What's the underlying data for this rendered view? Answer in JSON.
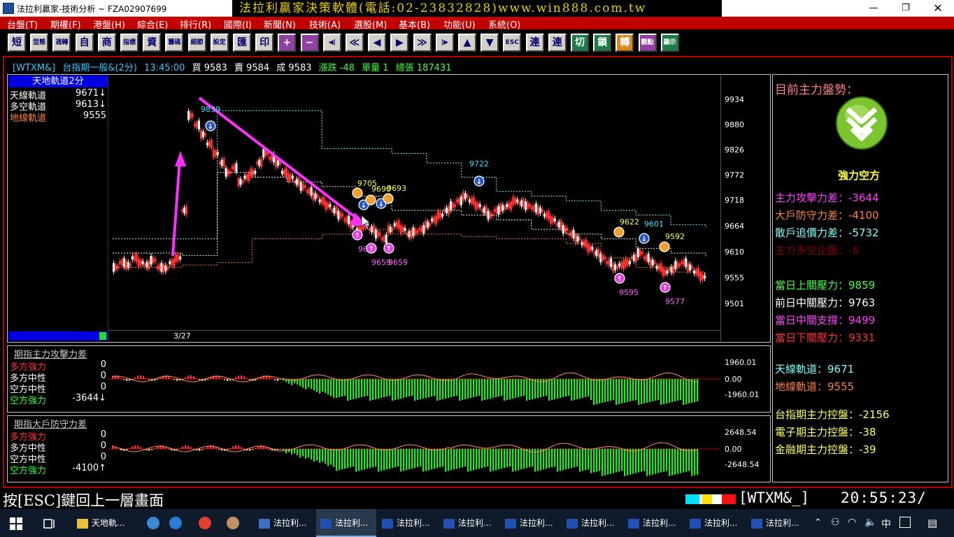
{
  "window": {
    "title": "法拉利贏家-技術分析 ~ FZA02907699",
    "ad_banner": "法拉利贏家決策軟體(電話:02-23832828)www.win888.com.tw"
  },
  "menu": [
    "台盤(T)",
    "期權(F)",
    "港盤(H)",
    "綜合(E)",
    "排行(R)",
    "國際(I)",
    "新聞(N)",
    "技術(A)",
    "選股(M)",
    "基本(B)",
    "功能(U)",
    "系統(O)"
  ],
  "toolbar": [
    "短",
    "型態",
    "週轉",
    "自",
    "商",
    "指標",
    "資",
    "籌碼",
    "細節",
    "設定",
    "匯",
    "印",
    "+",
    "−",
    "◀|",
    "≪",
    "◀",
    "▶",
    "≫",
    "|▶",
    "▲",
    "▼",
    "ESC",
    "連",
    "連",
    "切",
    "鎖",
    "轉",
    "觀點",
    "顯示"
  ],
  "ticker": {
    "symbol": "[WTXM&]",
    "name": "台指期一般&(2分)",
    "time": "13:45:00",
    "buy": "買 9583",
    "sell": "賣 9584",
    "deal": "成 9583",
    "change": "漲跌 -48",
    "volume": "單量 1",
    "total": "總張 187431"
  },
  "main_panel": {
    "title": "天地軌道2分",
    "legend": [
      {
        "label": "天線軌道",
        "value": "9671↓",
        "color": "#ffffff"
      },
      {
        "label": "多空軌道",
        "value": "9613↓",
        "color": "#ffffff"
      },
      {
        "label": "地線軌道",
        "value": "9555",
        "color": "#ff8040"
      }
    ],
    "date_label": "3/27",
    "y_ticks": [
      "9934",
      "9880",
      "9826",
      "9772",
      "9718",
      "9664",
      "9610",
      "9555",
      "9501"
    ],
    "signals_blue": [
      "9839",
      "9722",
      "9601"
    ],
    "signals_orange": [
      "9705",
      "9693",
      "9690",
      "9622",
      "9592"
    ],
    "signals_pink": [
      "96",
      "9659",
      "9659",
      "9595",
      "9577"
    ]
  },
  "sub_panel_1": {
    "title": "期指主力攻擊力差",
    "legend": [
      {
        "label": "多方強力",
        "value": "0",
        "color": "#ff3030"
      },
      {
        "label": "多方中性",
        "value": "0",
        "color": "#ffffff"
      },
      {
        "label": "空方中性",
        "value": "0",
        "color": "#ffffff"
      },
      {
        "label": "空方強力",
        "value": "-3644↓",
        "color": "#30ff30"
      }
    ],
    "y_ticks": [
      "1960.01",
      "0.00",
      "-1960.01"
    ]
  },
  "sub_panel_2": {
    "title": "期指大戶防守力差",
    "legend": [
      {
        "label": "多方強力",
        "value": "0",
        "color": "#ff3030"
      },
      {
        "label": "多方中性",
        "value": "0",
        "color": "#ffffff"
      },
      {
        "label": "空方中性",
        "value": "0",
        "color": "#ffffff"
      },
      {
        "label": "空方強力",
        "value": "-4100↑",
        "color": "#30ff30"
      }
    ],
    "y_ticks": [
      "2648.54",
      "0.00",
      "-2648.54"
    ]
  },
  "right_panel": {
    "heading": "目前主力盤勢：",
    "trend_label": "強力空方",
    "group1": [
      {
        "text": "主力攻擊力差：-3644",
        "color": "#ff40ff"
      },
      {
        "text": "大戶防守力差：-4100",
        "color": "#ff8040"
      },
      {
        "text": "散戶追價力差：-5732",
        "color": "#80ffff"
      },
      {
        "text": "主力多空企圖：-6",
        "color": "#800000"
      }
    ],
    "group2": [
      {
        "text": "當日上關壓力：9859",
        "color": "#40ff40"
      },
      {
        "text": "前日中關壓力：9763",
        "color": "#ffffff"
      },
      {
        "text": "當日中關支撐：9499",
        "color": "#ff40ff"
      },
      {
        "text": "當日下關壓力：9331",
        "color": "#ff3030"
      }
    ],
    "group3": [
      {
        "text": "天線軌道：9671",
        "color": "#80ffff"
      },
      {
        "text": "地線軌道：9555",
        "color": "#ff8040"
      }
    ],
    "group4": [
      {
        "text": "台指期主力控盤：-2156",
        "color": "#ffff60"
      },
      {
        "text": "電子期主力控盤：-38",
        "color": "#ffff60"
      },
      {
        "text": "金融期主力控盤：-39",
        "color": "#ffff60"
      }
    ]
  },
  "statusbar": {
    "hint": "按[ESC]鍵回上一層畫面",
    "symbol": "[WTXM&_]",
    "clock": "20:55:23/"
  },
  "taskbar": {
    "items": [
      "天地軌...",
      "法拉利...",
      "法拉利...",
      "法拉利...",
      "法拉利...",
      "法拉利...",
      "法拉利...",
      "法拉利...",
      "法拉利...",
      "法拉利..."
    ],
    "ime": "中"
  },
  "colors": {
    "frame_red": "#c00000",
    "candle_red": "#ff3030",
    "candle_white": "#ffffff",
    "bar_green": "#30ff30",
    "arrow_magenta": "#ff30ff"
  }
}
